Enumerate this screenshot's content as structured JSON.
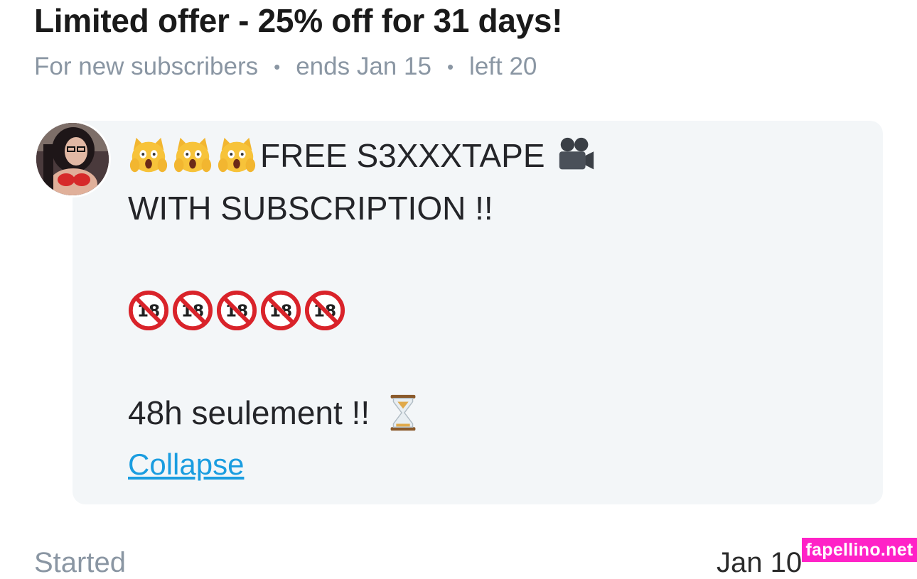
{
  "offer": {
    "title": "Limited offer - 25% off for 31 days!",
    "audience": "For new subscribers",
    "separator": "•",
    "ends": "ends Jan 15",
    "left": "left 20"
  },
  "message": {
    "line1_text": "FREE S3XXXTAPE",
    "line2_text": "WITH SUBSCRIPTION !!",
    "line4_text": "48h seulement !!",
    "collapse_label": "Collapse",
    "icons": {
      "line1_prefix": [
        "screaming-cat-icon",
        "screaming-cat-icon",
        "screaming-cat-icon"
      ],
      "line1_suffix": "movie-camera-icon",
      "line3": [
        "no-under-18-icon",
        "no-under-18-icon",
        "no-under-18-icon",
        "no-under-18-icon",
        "no-under-18-icon"
      ],
      "line4_suffix": "hourglass-icon"
    }
  },
  "next_row": {
    "left_text": "Started",
    "right_text": "Jan 10"
  },
  "watermark": "fapellino.net",
  "colors": {
    "link": "#1a9de0",
    "meta_text": "#8a96a3",
    "card_bg": "#f3f6f8",
    "watermark_bg": "#ff22c7"
  }
}
